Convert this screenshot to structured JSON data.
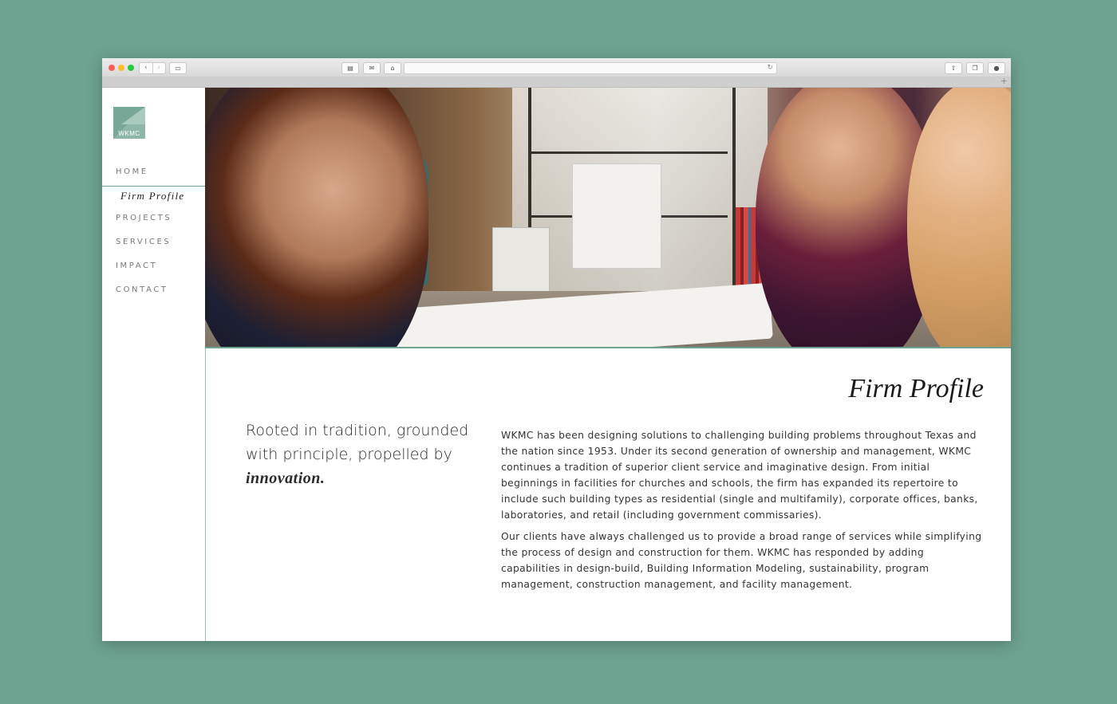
{
  "browser": {
    "nav_back": "‹",
    "nav_forward": "›",
    "reload": "↻",
    "new_tab": "+"
  },
  "logo": {
    "text": "WKMC"
  },
  "nav": {
    "home": "HOME",
    "firm_profile": "Firm Profile",
    "projects": "PROJECTS",
    "services": "SERVICES",
    "impact": "IMPACT",
    "contact": "CONTACT"
  },
  "page": {
    "title": "Firm Profile",
    "tagline_main": "Rooted in tradition, grounded with principle, propelled by ",
    "tagline_emphasis": "innovation.",
    "paragraph_1": "WKMC has been designing solutions to challenging building problems throughout Texas and the nation since 1953. Under its second generation of ownership and management, WKMC continues a tradition of superior client service and imaginative design. From initial beginnings in facilities for churches and schools, the firm has expanded its repertoire to include such building types as residential (single and multifamily), corporate offices, banks, laboratories, and retail (including government commissaries).",
    "paragraph_2": "Our clients have always challenged us to provide a broad range of services while simplifying the process of design and construction for them. WKMC has responded by adding capabilities in design-build, Building Information Modeling, sustainability, program management, construction management, and facility management."
  },
  "colors": {
    "background": "#6ea391",
    "accent": "#6ea391",
    "logo": "#8fb7a9"
  }
}
